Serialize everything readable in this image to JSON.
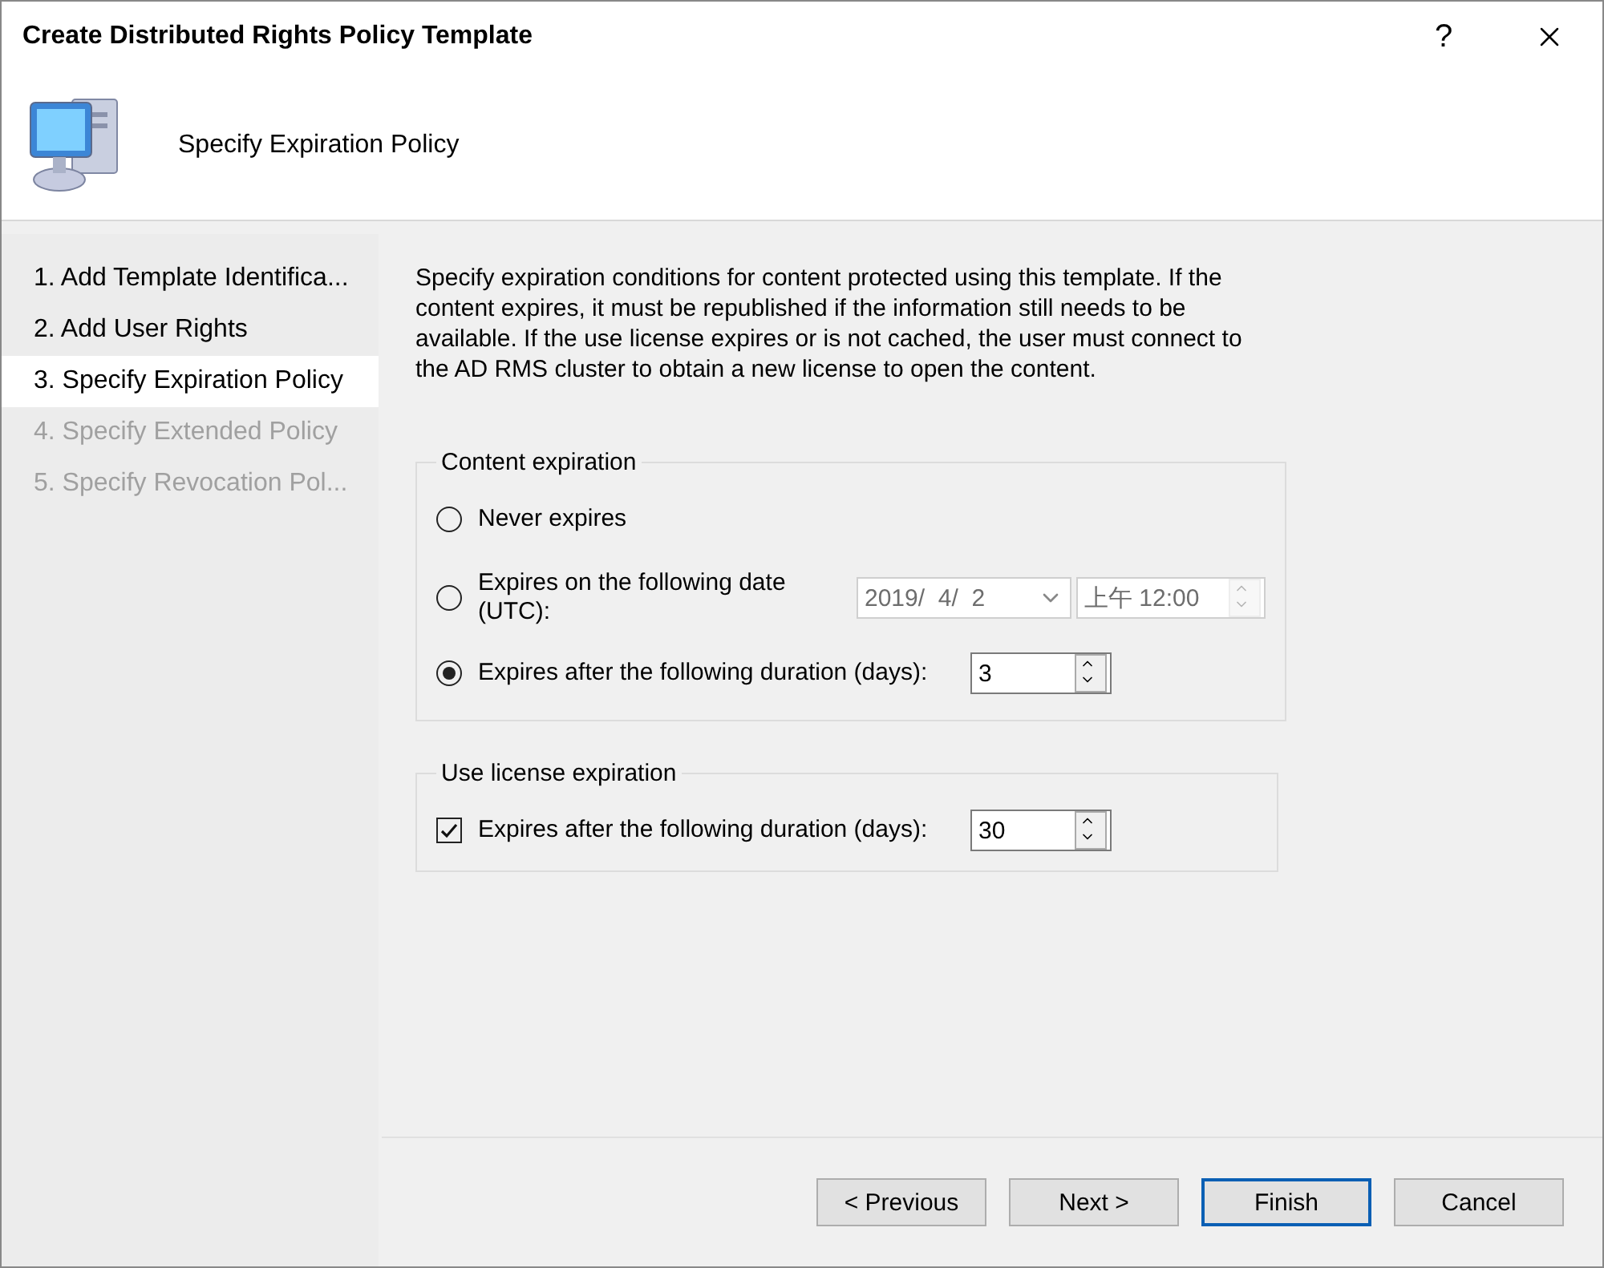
{
  "window": {
    "title": "Create Distributed Rights Policy Template",
    "help": "?"
  },
  "header": {
    "title": "Specify Expiration Policy"
  },
  "steps": [
    {
      "label": "1. Add Template Identifica...",
      "selected": false,
      "disabled": false
    },
    {
      "label": "2. Add User Rights",
      "selected": false,
      "disabled": false
    },
    {
      "label": "3. Specify Expiration Policy",
      "selected": true,
      "disabled": false
    },
    {
      "label": "4. Specify Extended Policy",
      "selected": false,
      "disabled": true
    },
    {
      "label": "5. Specify Revocation Pol...",
      "selected": false,
      "disabled": true
    }
  ],
  "description": "Specify expiration conditions for content protected using this template. If the content expires, it must be republished if the information still needs to be available. If the use license expires or is not cached, the user must connect to the AD RMS cluster to obtain a new license to open the content.",
  "content_expiration": {
    "title": "Content expiration",
    "options": [
      {
        "kind": "plain",
        "label": "Never expires",
        "selected": false
      },
      {
        "kind": "date",
        "label": "Expires on the following date (UTC):",
        "selected": false,
        "date": "2019/  4/  2",
        "time": "上午 12:00",
        "disabled": true
      },
      {
        "kind": "duration",
        "label": "Expires after the following duration (days):",
        "selected": true,
        "value": "3"
      }
    ]
  },
  "use_license_expiration": {
    "title": "Use license expiration",
    "label": "Expires after the following duration (days):",
    "checked": true,
    "value": "30"
  },
  "buttons": [
    {
      "label": "< Previous",
      "default": false
    },
    {
      "label": "Next >",
      "default": false
    },
    {
      "label": "Finish",
      "default": true
    },
    {
      "label": "Cancel",
      "default": false
    }
  ]
}
